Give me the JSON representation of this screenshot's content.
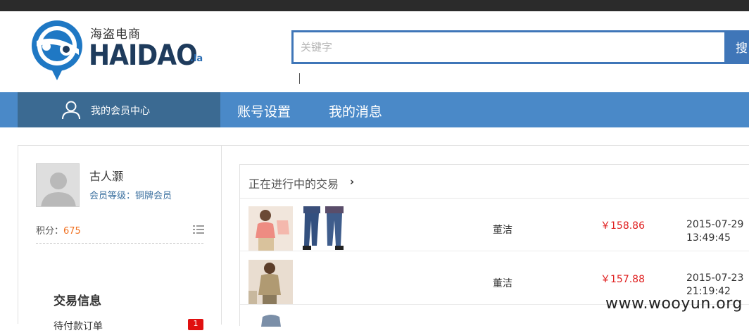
{
  "logo": {
    "cn": "海盗电商",
    "en": "HAIDAO",
    "suffix": ".la"
  },
  "search": {
    "placeholder": "关键字",
    "button_label": "搜"
  },
  "nav": {
    "member_center": "我的会员中心",
    "items": [
      "账号设置",
      "我的消息"
    ]
  },
  "profile": {
    "name": "古人灏",
    "level": "会员等级：铜牌会员",
    "points_label": "积分：",
    "points_value": "675"
  },
  "sidebar": {
    "section_title": "交易信息",
    "pending_label": "待付款订单",
    "pending_count": "1"
  },
  "trades": {
    "title": "正在进行中的交易",
    "arrow": "›",
    "rows": [
      {
        "buyer": "董洁",
        "price": "￥158.86",
        "date": "2015-07-29",
        "time": "13:49:45"
      },
      {
        "buyer": "董洁",
        "price": "￥157.88",
        "date": "2015-07-23",
        "time": "21:19:42"
      }
    ]
  },
  "watermark": "www.wooyun.org",
  "colors": {
    "nav": "#4a89c8",
    "nav_member": "#3b6a92",
    "search_border": "#3f76b8",
    "price": "#e02020",
    "points": "#f07020"
  }
}
